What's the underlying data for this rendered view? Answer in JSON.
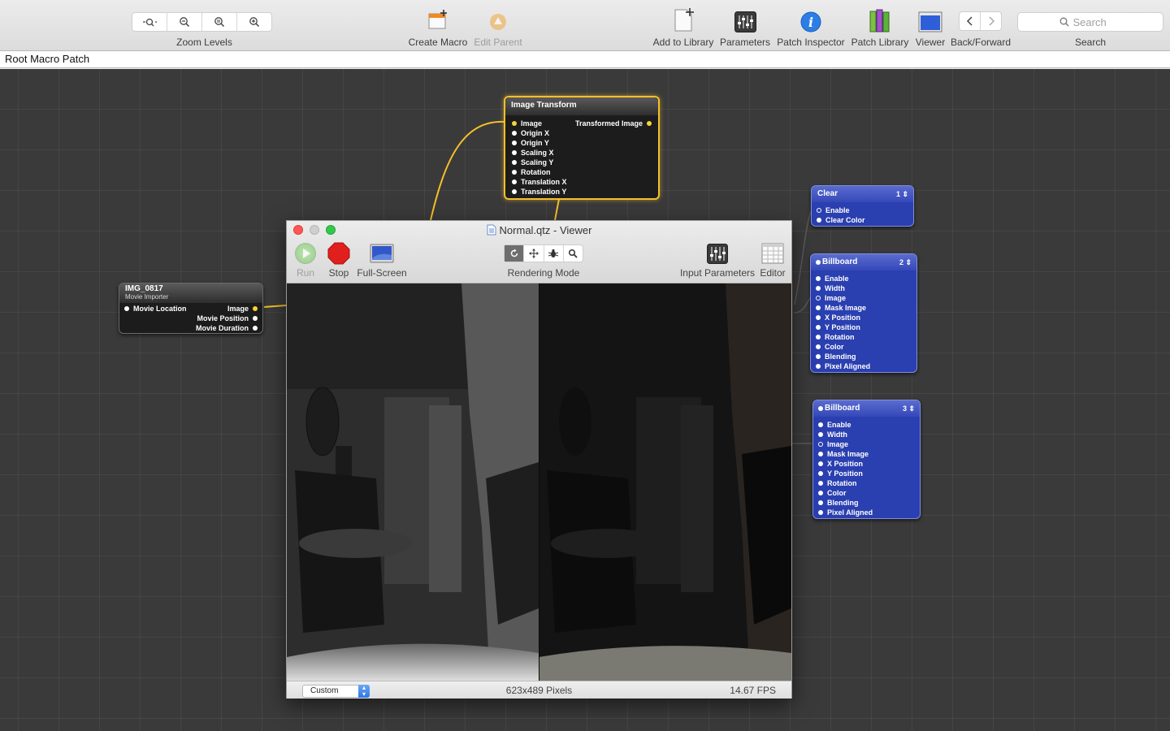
{
  "toolbar": {
    "zoom_label": "Zoom Levels",
    "create_macro_label": "Create Macro",
    "edit_parent_label": "Edit Parent",
    "add_to_library_label": "Add to Library",
    "parameters_label": "Parameters",
    "patch_inspector_label": "Patch Inspector",
    "patch_library_label": "Patch Library",
    "viewer_label": "Viewer",
    "back_forward_label": "Back/Forward",
    "search_label": "Search",
    "search_placeholder": "Search"
  },
  "breadcrumb": "Root Macro Patch",
  "patches": {
    "image_transform": {
      "title": "Image Transform",
      "inputs": [
        "Image",
        "Origin X",
        "Origin Y",
        "Scaling X",
        "Scaling Y",
        "Rotation",
        "Translation X",
        "Translation Y"
      ],
      "output": "Transformed Image"
    },
    "movie": {
      "title": "IMG_0817",
      "subtitle": "Movie Importer",
      "input": "Movie Location",
      "outputs": [
        "Image",
        "Movie Position",
        "Movie Duration"
      ]
    },
    "clear": {
      "title": "Clear",
      "layer": "1",
      "inputs": [
        "Enable",
        "Clear Color"
      ]
    },
    "billboard2": {
      "title": "Billboard",
      "layer": "2",
      "inputs": [
        "Enable",
        "Width",
        "Image",
        "Mask Image",
        "X Position",
        "Y Position",
        "Rotation",
        "Color",
        "Blending",
        "Pixel Aligned"
      ]
    },
    "billboard3": {
      "title": "Billboard",
      "layer": "3",
      "inputs": [
        "Enable",
        "Width",
        "Image",
        "Mask Image",
        "X Position",
        "Y Position",
        "Rotation",
        "Color",
        "Blending",
        "Pixel Aligned"
      ]
    }
  },
  "viewer": {
    "title": "Normal.qtz - Viewer",
    "run_label": "Run",
    "stop_label": "Stop",
    "fullscreen_label": "Full-Screen",
    "rendering_mode_label": "Rendering Mode",
    "input_parameters_label": "Input Parameters",
    "editor_label": "Editor",
    "size_option": "Custom",
    "pixels": "623x489 Pixels",
    "fps": "14.67 FPS"
  },
  "colors": {
    "canvas": "#3a3a3a",
    "wire": "#f5c02a",
    "selection": "#f5c02a",
    "consumer_patch": "#2a3fb0",
    "processor_patch": "#1c1c1c",
    "stop_red": "#e0201c",
    "run_green": "#7cc86a"
  }
}
